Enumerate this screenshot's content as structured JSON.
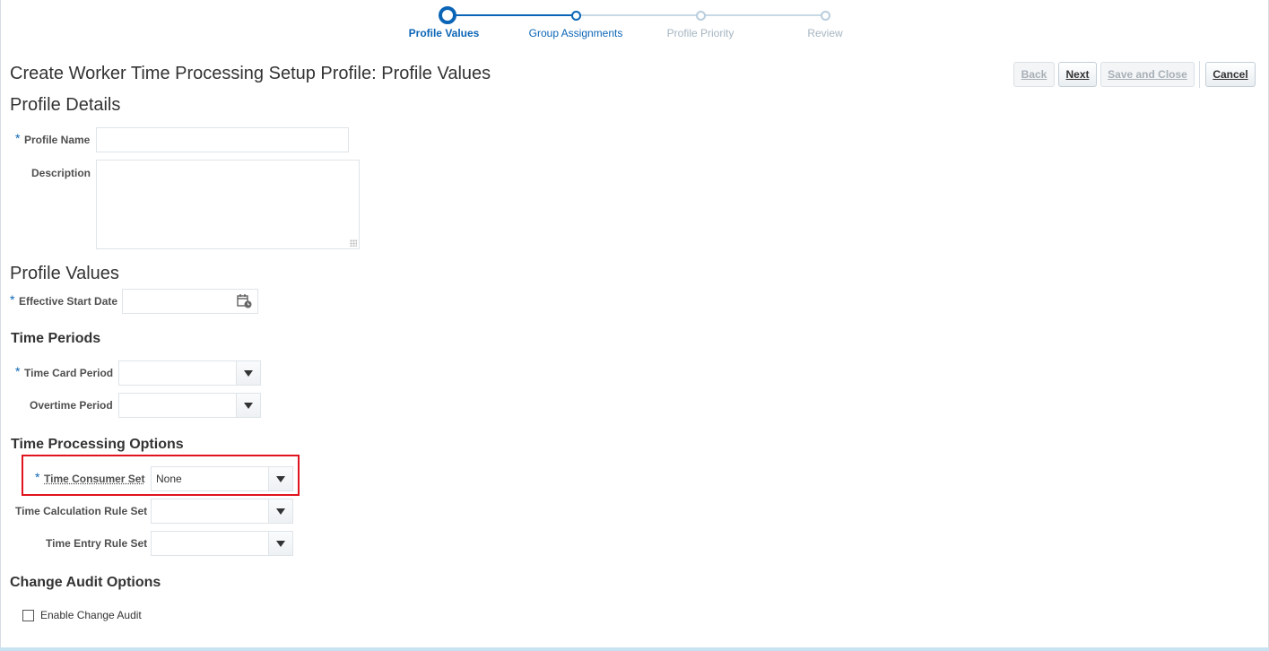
{
  "train": {
    "steps": [
      {
        "label": "Profile Values",
        "state": "current"
      },
      {
        "label": "Group Assignments",
        "state": "next"
      },
      {
        "label": "Profile Priority",
        "state": "inactive"
      },
      {
        "label": "Review",
        "state": "inactive"
      }
    ]
  },
  "page": {
    "title": "Create Worker Time Processing Setup Profile: Profile Values"
  },
  "toolbar": {
    "back_label": "Back",
    "next_label": "Next",
    "save_close_label": "Save and Close",
    "cancel_label": "Cancel"
  },
  "profile_details": {
    "heading": "Profile Details",
    "name_label": "Profile Name",
    "name_value": "",
    "description_label": "Description",
    "description_value": ""
  },
  "profile_values": {
    "heading": "Profile Values",
    "start_date_label": "Effective Start Date",
    "start_date_value": ""
  },
  "time_periods": {
    "heading": "Time Periods",
    "time_card_label": "Time Card Period",
    "time_card_value": "",
    "overtime_label": "Overtime Period",
    "overtime_value": ""
  },
  "processing_options": {
    "heading": "Time Processing Options",
    "consumer_label": "Time Consumer Set",
    "consumer_value": "None",
    "calc_rule_label": "Time Calculation Rule Set",
    "calc_rule_value": "",
    "entry_rule_label": "Time Entry Rule Set",
    "entry_rule_value": ""
  },
  "audit": {
    "heading": "Change Audit Options",
    "enable_label": "Enable Change Audit",
    "enabled": false
  },
  "required_marker": "*",
  "colors": {
    "accent": "#0b65b6",
    "highlight": "#e0141e",
    "inactive": "#a5b5c2"
  }
}
